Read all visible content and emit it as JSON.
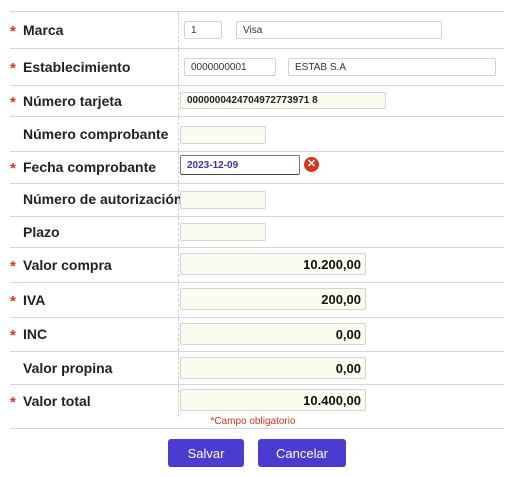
{
  "form": {
    "marca": {
      "label": "Marca",
      "required": true,
      "code": "1",
      "name": "Visa"
    },
    "establecimiento": {
      "label": "Establecimiento",
      "required": true,
      "code": "0000000001",
      "name": "ESTAB S.A"
    },
    "numero_tarjeta": {
      "label": "Número tarjeta",
      "required": true,
      "value": "0000000424704972773971 8"
    },
    "numero_comprobante": {
      "label": "Número comprobante",
      "required": false,
      "value": ""
    },
    "fecha_comprobante": {
      "label": "Fecha comprobante",
      "required": true,
      "value": "2023-12-09",
      "error_icon": "error-x-icon"
    },
    "numero_autorizacion": {
      "label": "Número de autorización",
      "required": false,
      "value": ""
    },
    "plazo": {
      "label": "Plazo",
      "required": false,
      "value": ""
    },
    "valor_compra": {
      "label": "Valor compra",
      "required": true,
      "value": "10.200,00"
    },
    "iva": {
      "label": "IVA",
      "required": true,
      "value": "200,00"
    },
    "inc": {
      "label": "INC",
      "required": true,
      "value": "0,00"
    },
    "valor_propina": {
      "label": "Valor propina",
      "required": false,
      "value": "0,00"
    },
    "valor_total": {
      "label": "Valor total",
      "required": true,
      "value": "10.400,00"
    }
  },
  "required_marker": "*",
  "required_note": "*Campo obligatorio",
  "buttons": {
    "save": "Salvar",
    "cancel": "Cancelar"
  },
  "colors": {
    "accent": "#4a3bd1",
    "required": "#d9341e",
    "field_bg": "#fbfbf0",
    "date_text": "#3a35a8"
  }
}
